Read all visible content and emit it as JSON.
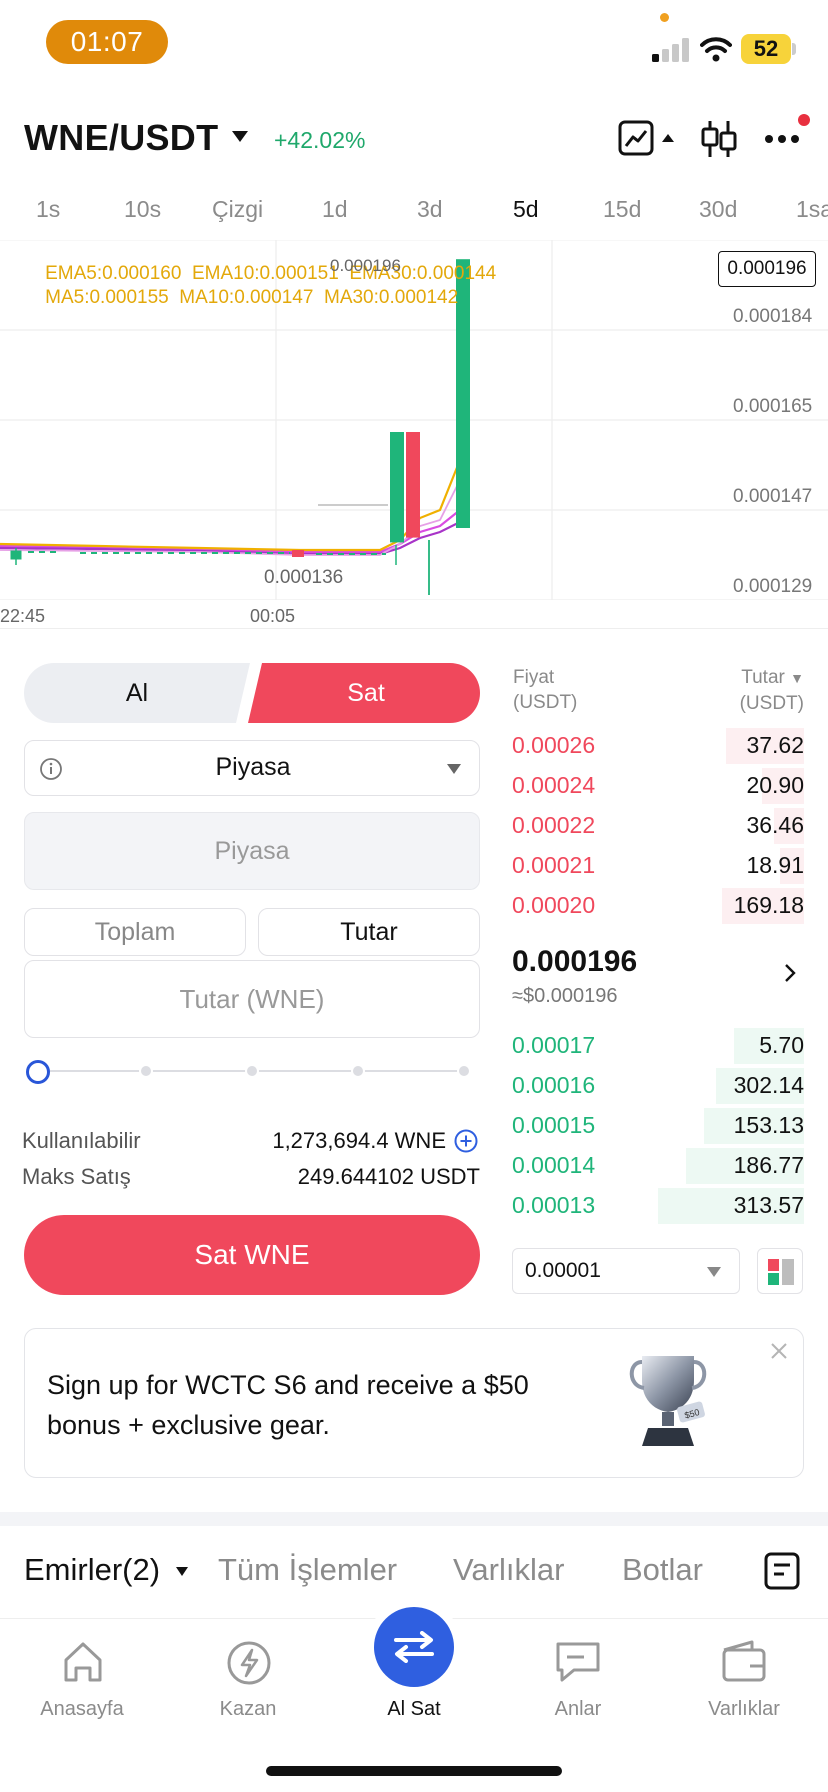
{
  "status_bar": {
    "time": "01:07",
    "battery": "52"
  },
  "header": {
    "pair": "WNE/USDT",
    "change": "+42.02%"
  },
  "intervals": [
    {
      "label": "1s",
      "active": false
    },
    {
      "label": "10s",
      "active": false
    },
    {
      "label": "Çizgi",
      "active": false
    },
    {
      "label": "1d",
      "active": false
    },
    {
      "label": "3d",
      "active": false
    },
    {
      "label": "5d",
      "active": true
    },
    {
      "label": "15d",
      "active": false
    },
    {
      "label": "30d",
      "active": false
    },
    {
      "label": "1sa",
      "active": false
    }
  ],
  "chart_data": {
    "type": "candlestick",
    "indicators": {
      "ema": "EMA5:0.000160  EMA10:0.000151  EMA30:0.000144",
      "ma": "MA5:0.000155  MA10:0.000147  MA30:0.000142"
    },
    "y_ticks": [
      "0.000184",
      "0.000165",
      "0.000147",
      "0.000129"
    ],
    "x_ticks": [
      "22:45",
      "00:05"
    ],
    "last_price_tag": "0.000196",
    "high_marker": "0.000196",
    "low_marker": "0.000136",
    "ylim": [
      0.000125,
      0.0002
    ]
  },
  "trade": {
    "buy_label": "Al",
    "sell_label": "Sat",
    "order_type": "Piyasa",
    "price_placeholder": "Piyasa",
    "total_tab": "Toplam",
    "amount_tab": "Tutar",
    "qty_placeholder": "Tutar (WNE)",
    "slider_percent": 0,
    "available_label": "Kullanılabilir",
    "available_value": "1,273,694.4 WNE",
    "max_sell_label": "Maks Satış",
    "max_sell_value": "249.644102 USDT",
    "sell_button": "Sat WNE"
  },
  "orderbook": {
    "price_header": "Fiyat",
    "price_unit": "(USDT)",
    "amount_header": "Tutar",
    "amount_unit": "(USDT)",
    "asks": [
      {
        "price": "0.00026",
        "amount": "37.62"
      },
      {
        "price": "0.00024",
        "amount": "20.90"
      },
      {
        "price": "0.00022",
        "amount": "36.46"
      },
      {
        "price": "0.00021",
        "amount": "18.91"
      },
      {
        "price": "0.00020",
        "amount": "169.18"
      }
    ],
    "last_price": "0.000196",
    "last_price_usd": "≈$0.000196",
    "bids": [
      {
        "price": "0.00017",
        "amount": "5.70"
      },
      {
        "price": "0.00016",
        "amount": "302.14"
      },
      {
        "price": "0.00015",
        "amount": "153.13"
      },
      {
        "price": "0.00014",
        "amount": "186.77"
      },
      {
        "price": "0.00013",
        "amount": "313.57"
      }
    ],
    "precision": "0.00001"
  },
  "banner": {
    "text": "Sign up for WCTC S6 and receive a $50 bonus + exclusive gear.",
    "trophy_badge": "$50"
  },
  "order_tabs": {
    "orders": "Emirler(2)",
    "all_trades": "Tüm İşlemler",
    "assets": "Varlıklar",
    "bots": "Botlar"
  },
  "nav": {
    "home": "Anasayfa",
    "earn": "Kazan",
    "trade": "Al Sat",
    "moments": "Anlar",
    "assets": "Varlıklar"
  },
  "colors": {
    "up": "#1fb57a",
    "down": "#f0485c",
    "accent": "#2f5fe0"
  }
}
